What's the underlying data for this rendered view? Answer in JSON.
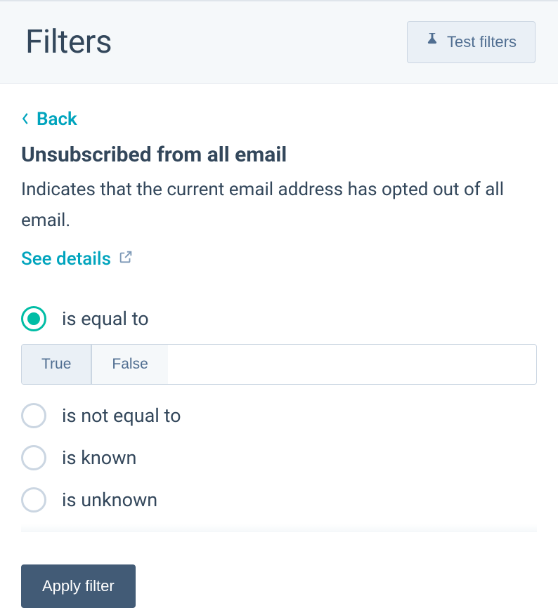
{
  "header": {
    "title": "Filters",
    "test_button": "Test filters"
  },
  "nav": {
    "back": "Back"
  },
  "filter": {
    "title": "Unsubscribed from all email",
    "description": "Indicates that the current email address has opted out of all email.",
    "details_link": "See details"
  },
  "options": {
    "items": [
      {
        "label": "is equal to",
        "selected": true
      },
      {
        "label": "is not equal to",
        "selected": false
      },
      {
        "label": "is known",
        "selected": false
      },
      {
        "label": "is unknown",
        "selected": false
      }
    ],
    "toggle": {
      "true_label": "True",
      "false_label": "False",
      "value": "True"
    }
  },
  "actions": {
    "apply": "Apply filter"
  },
  "colors": {
    "accent_teal": "#00a4bd",
    "accent_green": "#00bda5",
    "button_bg": "#425b76",
    "header_bg": "#f5f8fa",
    "border": "#cbd6e2",
    "text": "#33475b"
  }
}
